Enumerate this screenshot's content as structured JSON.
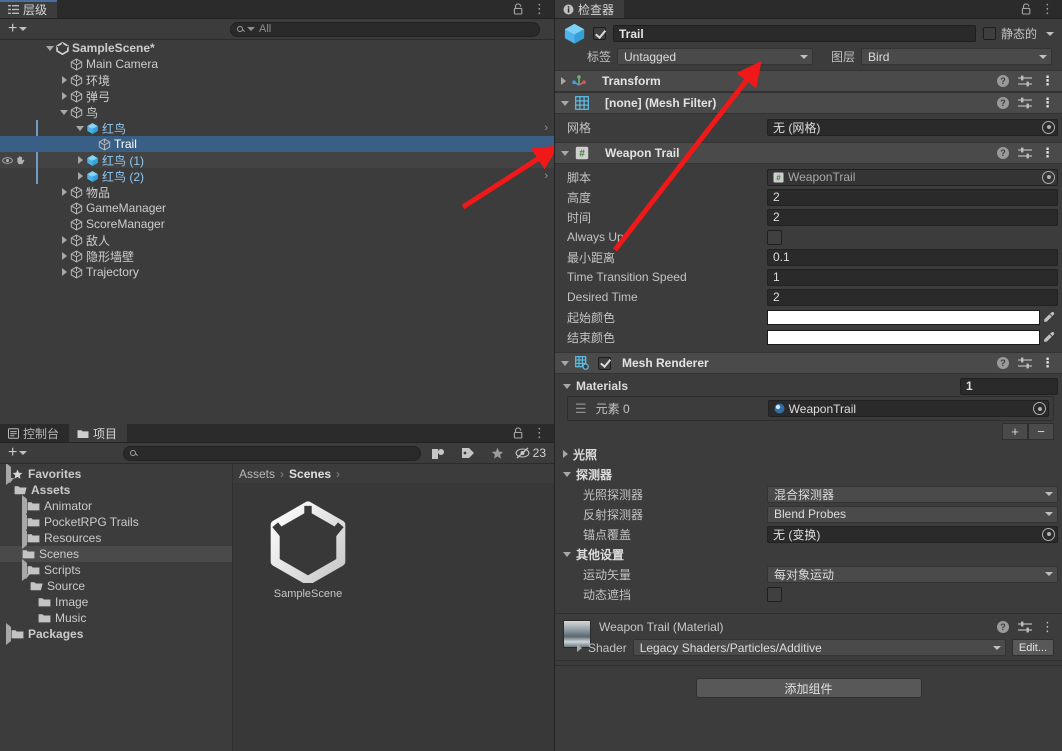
{
  "hierarchy": {
    "tab_label": "层级",
    "tab_icon": "hierarchy-icon",
    "search_placeholder": "All",
    "add_label": "+",
    "items": [
      {
        "label": "SampleScene*",
        "depth": 0,
        "icon": "unity-scene-icon",
        "twisty": "down",
        "bold": true,
        "selected": false,
        "chevron": false
      },
      {
        "label": "Main Camera",
        "depth": 1,
        "icon": "gameobject-icon",
        "twisty": "none",
        "selected": false,
        "chevron": false
      },
      {
        "label": "环境",
        "depth": 1,
        "icon": "gameobject-icon",
        "twisty": "right",
        "selected": false,
        "chevron": false
      },
      {
        "label": "弹弓",
        "depth": 1,
        "icon": "gameobject-icon",
        "twisty": "right",
        "selected": false,
        "chevron": false
      },
      {
        "label": "鸟",
        "depth": 1,
        "icon": "gameobject-icon",
        "twisty": "down",
        "selected": false,
        "chevron": false
      },
      {
        "label": "红鸟",
        "depth": 2,
        "icon": "prefab-icon",
        "twisty": "down",
        "prefab": true,
        "selected": false,
        "chevron": true
      },
      {
        "label": "Trail",
        "depth": 3,
        "icon": "gameobject-icon",
        "twisty": "none",
        "selected": true,
        "chevron": false
      },
      {
        "label": "红鸟 (1)",
        "depth": 2,
        "icon": "prefab-icon",
        "twisty": "right",
        "prefab": true,
        "selected": false,
        "hovered": true,
        "chevron": true,
        "visibility": true
      },
      {
        "label": "红鸟 (2)",
        "depth": 2,
        "icon": "prefab-icon",
        "twisty": "right",
        "prefab": true,
        "selected": false,
        "chevron": true
      },
      {
        "label": "物品",
        "depth": 1,
        "icon": "gameobject-icon",
        "twisty": "right",
        "selected": false,
        "chevron": false
      },
      {
        "label": "GameManager",
        "depth": 1,
        "icon": "gameobject-icon",
        "twisty": "none",
        "selected": false,
        "chevron": false
      },
      {
        "label": "ScoreManager",
        "depth": 1,
        "icon": "gameobject-icon",
        "twisty": "none",
        "selected": false,
        "chevron": false
      },
      {
        "label": "敌人",
        "depth": 1,
        "icon": "gameobject-icon",
        "twisty": "right",
        "selected": false,
        "chevron": false
      },
      {
        "label": "隐形墙壁",
        "depth": 1,
        "icon": "gameobject-icon",
        "twisty": "right",
        "selected": false,
        "chevron": false
      },
      {
        "label": "Trajectory",
        "depth": 1,
        "icon": "gameobject-icon",
        "twisty": "right",
        "selected": false,
        "chevron": false
      }
    ]
  },
  "project": {
    "tabs": [
      {
        "label": "控制台",
        "icon": "console-icon",
        "active": false
      },
      {
        "label": "项目",
        "icon": "folder-icon",
        "active": true
      }
    ],
    "search_placeholder": "",
    "hidden_count": "23",
    "breadcrumb": [
      "Assets",
      "Scenes"
    ],
    "tree": [
      {
        "label": "Favorites",
        "depth": 0,
        "twisty": "right",
        "icon": "star-icon",
        "bold": true
      },
      {
        "label": "Assets",
        "depth": 0,
        "twisty": "down",
        "icon": "folder-open-icon",
        "bold": true
      },
      {
        "label": "Animator",
        "depth": 1,
        "twisty": "right",
        "icon": "folder-icon"
      },
      {
        "label": "PocketRPG Trails",
        "depth": 1,
        "twisty": "right",
        "icon": "folder-icon"
      },
      {
        "label": "Resources",
        "depth": 1,
        "twisty": "right",
        "icon": "folder-icon"
      },
      {
        "label": "Scenes",
        "depth": 1,
        "twisty": "none",
        "icon": "folder-icon",
        "selected": true
      },
      {
        "label": "Scripts",
        "depth": 1,
        "twisty": "right",
        "icon": "folder-icon"
      },
      {
        "label": "Source",
        "depth": 1,
        "twisty": "down",
        "icon": "folder-open-icon"
      },
      {
        "label": "Image",
        "depth": 2,
        "twisty": "none",
        "icon": "folder-icon"
      },
      {
        "label": "Music",
        "depth": 2,
        "twisty": "none",
        "icon": "folder-icon"
      },
      {
        "label": "Packages",
        "depth": 0,
        "twisty": "right",
        "icon": "folder-icon",
        "bold": true
      }
    ],
    "assets": [
      {
        "label": "SampleScene",
        "icon": "unity-scene-asset-icon"
      }
    ]
  },
  "inspector": {
    "tab_label": "检查器",
    "object": {
      "name": "Trail",
      "enabled": true,
      "static_label": "静态的",
      "static_checked": false,
      "tag_label": "标签",
      "tag_value": "Untagged",
      "layer_label": "图层",
      "layer_value": "Bird"
    },
    "components": [
      {
        "name": "Transform",
        "icon": "transform-icon",
        "expanded": false,
        "has_checkbox": false
      },
      {
        "name": "[none] (Mesh Filter)",
        "icon": "mesh-filter-icon",
        "expanded": true,
        "has_checkbox": false,
        "rows": [
          {
            "label": "网格",
            "type": "object",
            "value": "无 (网格)"
          }
        ]
      },
      {
        "name": "Weapon Trail",
        "icon": "script-icon",
        "expanded": true,
        "has_checkbox": false,
        "rows": [
          {
            "label": "脚本",
            "type": "object",
            "value": "WeaponTrail",
            "disabled": true,
            "badge": "script-badge"
          },
          {
            "label": "高度",
            "type": "number",
            "value": "2"
          },
          {
            "label": "时间",
            "type": "number",
            "value": "2"
          },
          {
            "label": "Always Up",
            "type": "checkbox",
            "value": false
          },
          {
            "label": "最小距离",
            "type": "number",
            "value": "0.1"
          },
          {
            "label": "Time Transition Speed",
            "type": "number",
            "value": "1"
          },
          {
            "label": "Desired Time",
            "type": "number",
            "value": "2"
          },
          {
            "label": "起始颜色",
            "type": "color",
            "value": "#ffffff"
          },
          {
            "label": "结束颜色",
            "type": "color",
            "value": "#ffffff"
          }
        ]
      }
    ],
    "mesh_renderer": {
      "name": "Mesh Renderer",
      "icon": "mesh-renderer-icon",
      "enabled": true,
      "materials_label": "Materials",
      "materials_count": "1",
      "element_label": "元素 0",
      "element_value": "WeaponTrail",
      "add_btn": "+",
      "remove_btn": "−",
      "lighting_label": "光照",
      "probes_label": "探测器",
      "probe_rows": [
        {
          "label": "光照探测器",
          "type": "dropdown",
          "value": "混合探测器"
        },
        {
          "label": "反射探测器",
          "type": "dropdown",
          "value": "Blend Probes"
        },
        {
          "label": "锚点覆盖",
          "type": "object",
          "value": "无 (变换)"
        }
      ],
      "other_label": "其他设置",
      "other_rows": [
        {
          "label": "运动矢量",
          "type": "dropdown",
          "value": "每对象运动"
        },
        {
          "label": "动态遮挡",
          "type": "checkbox",
          "value": false
        }
      ]
    },
    "material_preview": {
      "title": "Weapon Trail (Material)",
      "shader_label": "Shader",
      "shader_value": "Legacy Shaders/Particles/Additive",
      "edit_label": "Edit..."
    },
    "add_component_label": "添加组件"
  },
  "colors": {
    "selection_blue": "#3a5f86",
    "prefab_blue": "#8ec8f0",
    "arrow_red": "#f01818",
    "panel_bg": "#3c3c3c",
    "header_bg": "#4a4a4a"
  }
}
